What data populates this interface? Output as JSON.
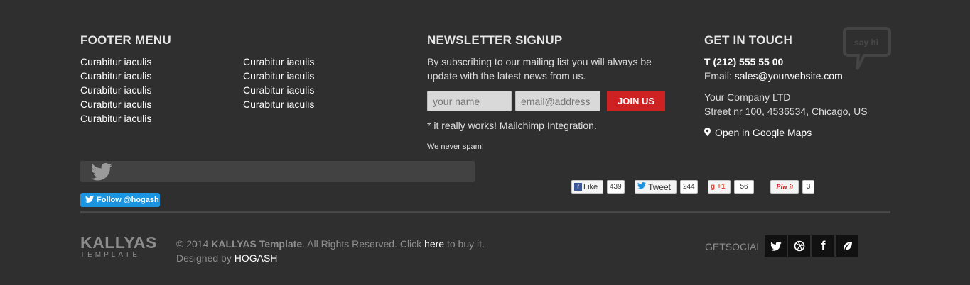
{
  "footer_menu": {
    "title": "FOOTER MENU",
    "col1": [
      "Curabitur iaculis",
      "Curabitur iaculis",
      "Curabitur iaculis",
      "Curabitur iaculis",
      "Curabitur iaculis"
    ],
    "col2": [
      "Curabitur iaculis",
      "Curabitur iaculis",
      "Curabitur iaculis",
      "Curabitur iaculis"
    ]
  },
  "newsletter": {
    "title": "NEWSLETTER SIGNUP",
    "text_line1": "By subscribing to our mailing list you will always be",
    "text_line2": "update with the latest news from us.",
    "name_placeholder": "your name",
    "email_placeholder": "email@address",
    "join_label": "JOIN US",
    "note": "* it really works! Mailchimp Integration.",
    "no_spam": "We never spam!"
  },
  "contact": {
    "title": "GET IN TOUCH",
    "say_hi": "say hi",
    "phone": "T (212) 555 55 00",
    "email_label": "Email: ",
    "email": "sales@yourwebsite.com",
    "company": "Your Company LTD",
    "address": "Street nr 100, 4536534, Chicago, US",
    "maps_link": "Open in Google Maps"
  },
  "twitter": {
    "follow_label": "Follow @hogash"
  },
  "social_counts": {
    "fb_label": "Like",
    "fb_count": "439",
    "tweet_label": "Tweet",
    "tweet_count": "244",
    "gplus_label": "+1",
    "gplus_count": "56",
    "pin_label": "Pin it",
    "pin_count": "3"
  },
  "bottom": {
    "logo_main": "KALLYAS",
    "logo_sub": "TEMPLATE",
    "copyright_pre": "© 2014 ",
    "copyright_brand": "KALLYAS Template",
    "copyright_mid": ". All Rights Reserved. Click ",
    "copyright_link": "here",
    "copyright_post": " to buy it.",
    "designed_pre": "Designed by ",
    "designed_brand": "HOGASH",
    "getsocial_label": "GETSOCIAL"
  },
  "colors": {
    "background": "#2f2f2f",
    "accent_red": "#cd2122",
    "twitter_blue": "#1b95e0"
  }
}
